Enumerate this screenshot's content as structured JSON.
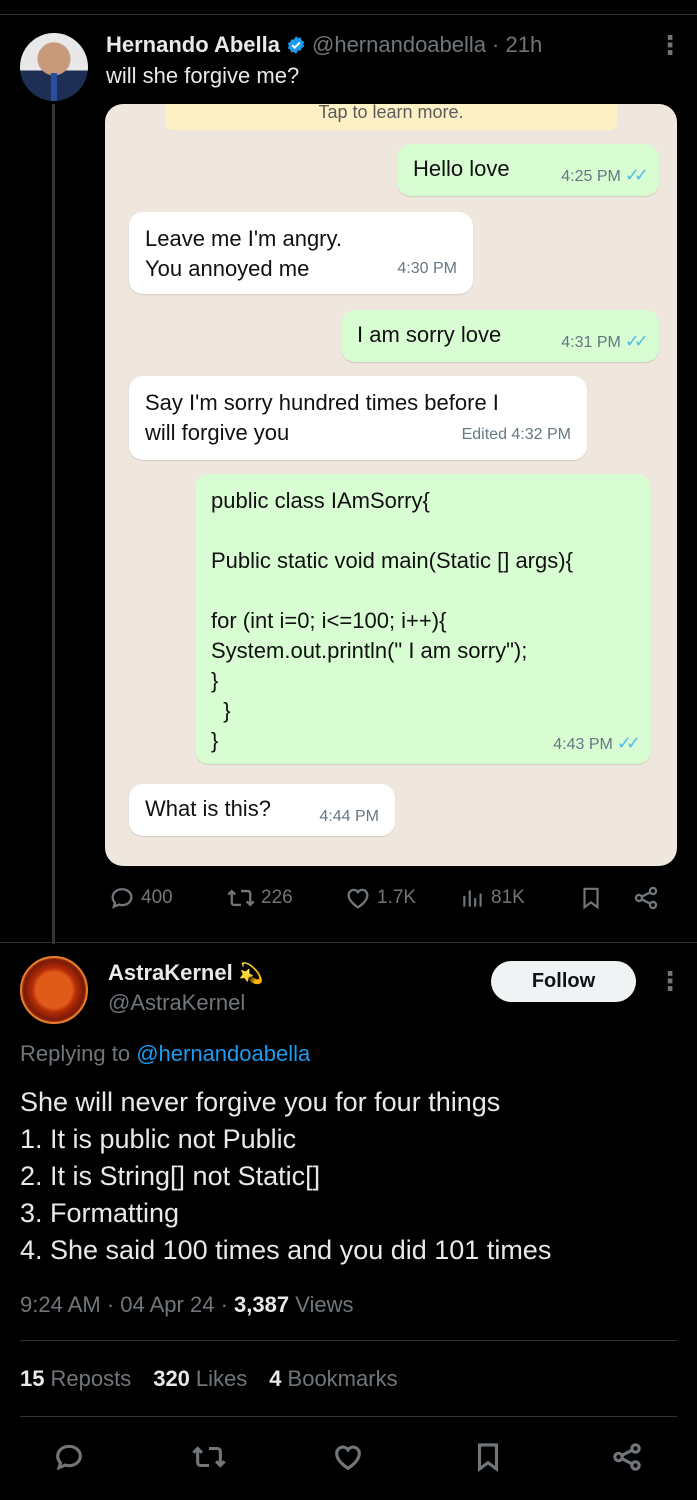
{
  "tweet": {
    "author_name": "Hernando Abella",
    "author_handle": "@hernandoabella",
    "age": "· 21h",
    "text": "will she forgive me?",
    "chat": {
      "banner": "Tap to learn more.",
      "messages": [
        {
          "dir": "out",
          "text": "Hello love",
          "time": "4:25 PM"
        },
        {
          "dir": "in",
          "lines": [
            "Leave me I'm angry.",
            "You annoyed me"
          ],
          "time": "4:30 PM"
        },
        {
          "dir": "out",
          "text": "I am sorry love",
          "time": "4:31 PM"
        },
        {
          "dir": "in",
          "lines": [
            "Say I'm sorry hundred times before I",
            "will forgive you"
          ],
          "time": "Edited 4:32 PM"
        },
        {
          "dir": "out",
          "code": [
            "public class IAmSorry{",
            "",
            "Public static void main(Static [] args){",
            "",
            "for (int i=0; i<=100; i++){",
            "System.out.println(\" I am sorry\");",
            "}",
            "  }",
            "}"
          ],
          "time": "4:43 PM"
        },
        {
          "dir": "in",
          "text": "What is this?",
          "time": "4:44 PM"
        }
      ]
    },
    "counts": {
      "replies": "400",
      "reposts": "226",
      "likes": "1.7K",
      "views": "81K"
    }
  },
  "reply": {
    "author_name": "AstraKernel",
    "author_emoji": "💫",
    "author_handle": "@AstraKernel",
    "follow_label": "Follow",
    "replying_prefix": "Replying to",
    "replying_to": "@hernandoabella",
    "lines": [
      "She will never forgive you for four things",
      "1. It is public not Public",
      "2. It is String[] not Static[]",
      "3. Formatting",
      "4. She said 100 times and you did 101 times"
    ],
    "time": "9:24 AM · 04 Apr 24 ·",
    "views_count": "3,387",
    "views_label": "Views",
    "reposts_count": "15",
    "reposts_label": "Reposts",
    "likes_count": "320",
    "likes_label": "Likes",
    "bookmarks_count": "4",
    "bookmarks_label": "Bookmarks"
  },
  "colors": {
    "accent": "#1d9bf0",
    "muted": "#71767b",
    "bubble_out": "#d9fdd3",
    "bubble_in": "#ffffff",
    "chat_bg": "#efe7dd"
  },
  "icons": [
    "verified-badge-icon",
    "more-icon",
    "reply-icon",
    "repost-icon",
    "like-icon",
    "views-icon",
    "bookmark-icon",
    "share-icon",
    "read-receipt-icon"
  ]
}
